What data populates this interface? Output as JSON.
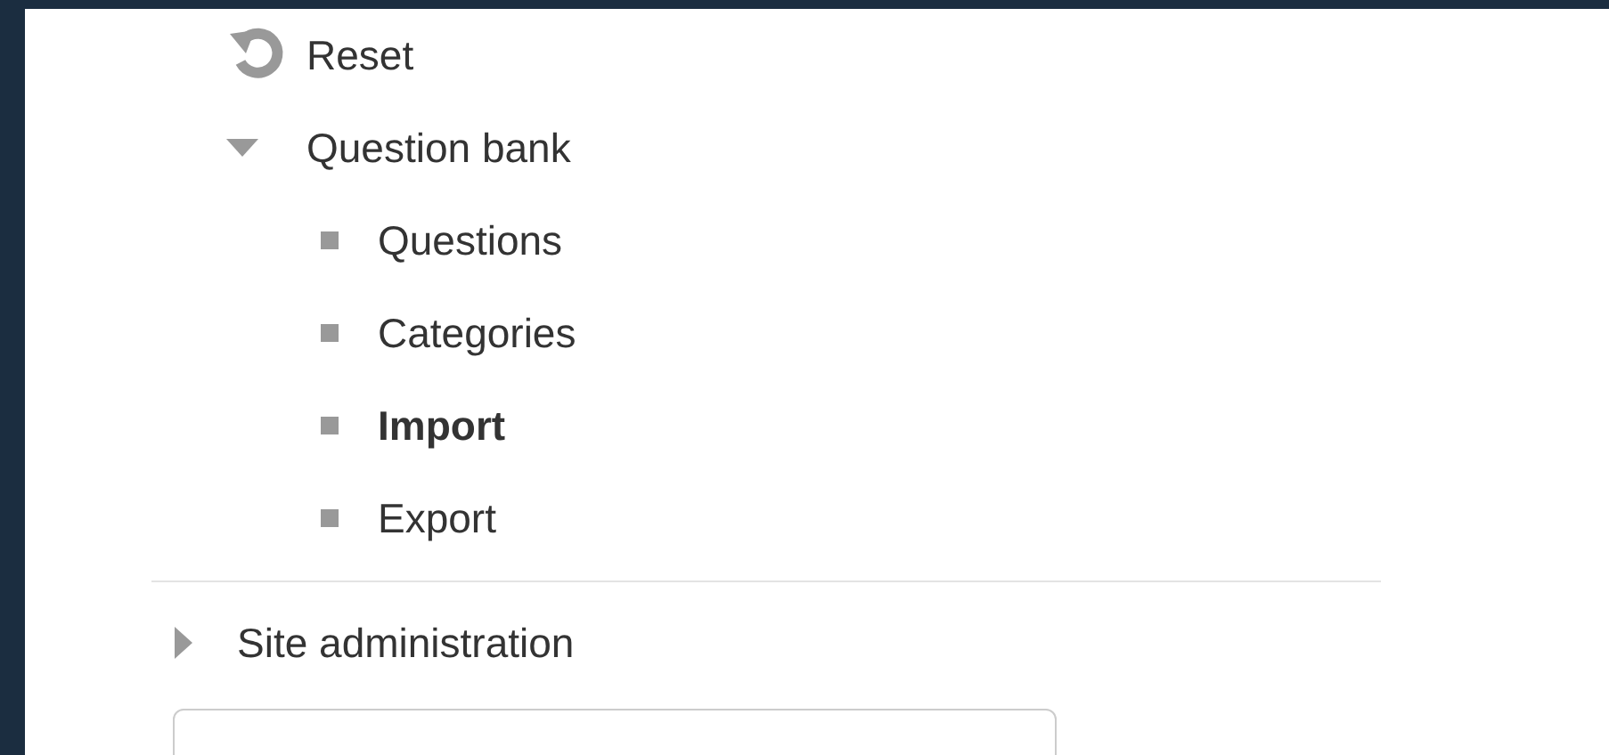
{
  "navigation": {
    "items": [
      {
        "kind": "action",
        "label": "Reset"
      },
      {
        "kind": "branch",
        "label": "Question bank",
        "expanded": true,
        "children": [
          {
            "label": "Questions",
            "selected": false
          },
          {
            "label": "Categories",
            "selected": false
          },
          {
            "label": "Import",
            "selected": true
          },
          {
            "label": "Export",
            "selected": false
          }
        ]
      }
    ]
  },
  "administration": {
    "items": [
      {
        "kind": "branch",
        "label": "Site administration",
        "expanded": false
      }
    ]
  },
  "block_input": {
    "kind": "text"
  }
}
